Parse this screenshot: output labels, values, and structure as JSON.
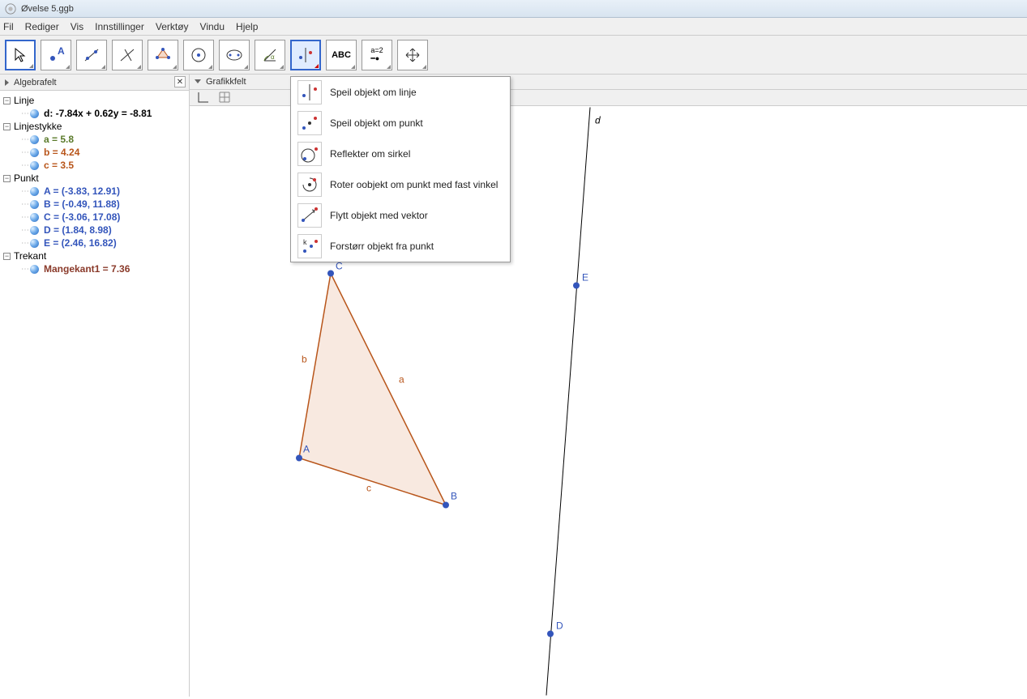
{
  "title": "Øvelse 5.ggb",
  "menu": [
    "Fil",
    "Rediger",
    "Vis",
    "Innstillinger",
    "Verktøy",
    "Vindu",
    "Hjelp"
  ],
  "panels": {
    "algebra": "Algebrafelt",
    "graphics": "Grafikkfelt"
  },
  "tree": {
    "linje": {
      "label": "Linje",
      "items": [
        {
          "text": "d: -7.84x + 0.62y = -8.81",
          "cls": "bold"
        }
      ]
    },
    "linjestykke": {
      "label": "Linjestykke",
      "items": [
        {
          "text": "a = 5.8",
          "cls": "colA"
        },
        {
          "text": "b = 4.24",
          "cls": "colB"
        },
        {
          "text": "c = 3.5",
          "cls": "colB"
        }
      ]
    },
    "punkt": {
      "label": "Punkt",
      "items": [
        {
          "text": "A = (-3.83, 12.91)",
          "cls": "colC"
        },
        {
          "text": "B = (-0.49, 11.88)",
          "cls": "colC"
        },
        {
          "text": "C = (-3.06, 17.08)",
          "cls": "colC"
        },
        {
          "text": "D = (1.84, 8.98)",
          "cls": "colC"
        },
        {
          "text": "E = (2.46, 16.82)",
          "cls": "colC"
        }
      ]
    },
    "trekant": {
      "label": "Trekant",
      "items": [
        {
          "text": "Mangekant1 = 7.36",
          "cls": "colD"
        }
      ]
    }
  },
  "dropdown": [
    "Speil objekt om linje",
    "Speil objekt om punkt",
    "Reflekter om sirkel",
    "Roter oobjekt om punkt med fast vinkel",
    "Flytt objekt med vektor",
    "Forstørr objekt fra punkt"
  ],
  "graph": {
    "lineLabel": "d",
    "points": {
      "A": "A",
      "B": "B",
      "C": "C",
      "D": "D",
      "E": "E"
    },
    "sides": {
      "a": "a",
      "b": "b",
      "c": "c"
    }
  }
}
